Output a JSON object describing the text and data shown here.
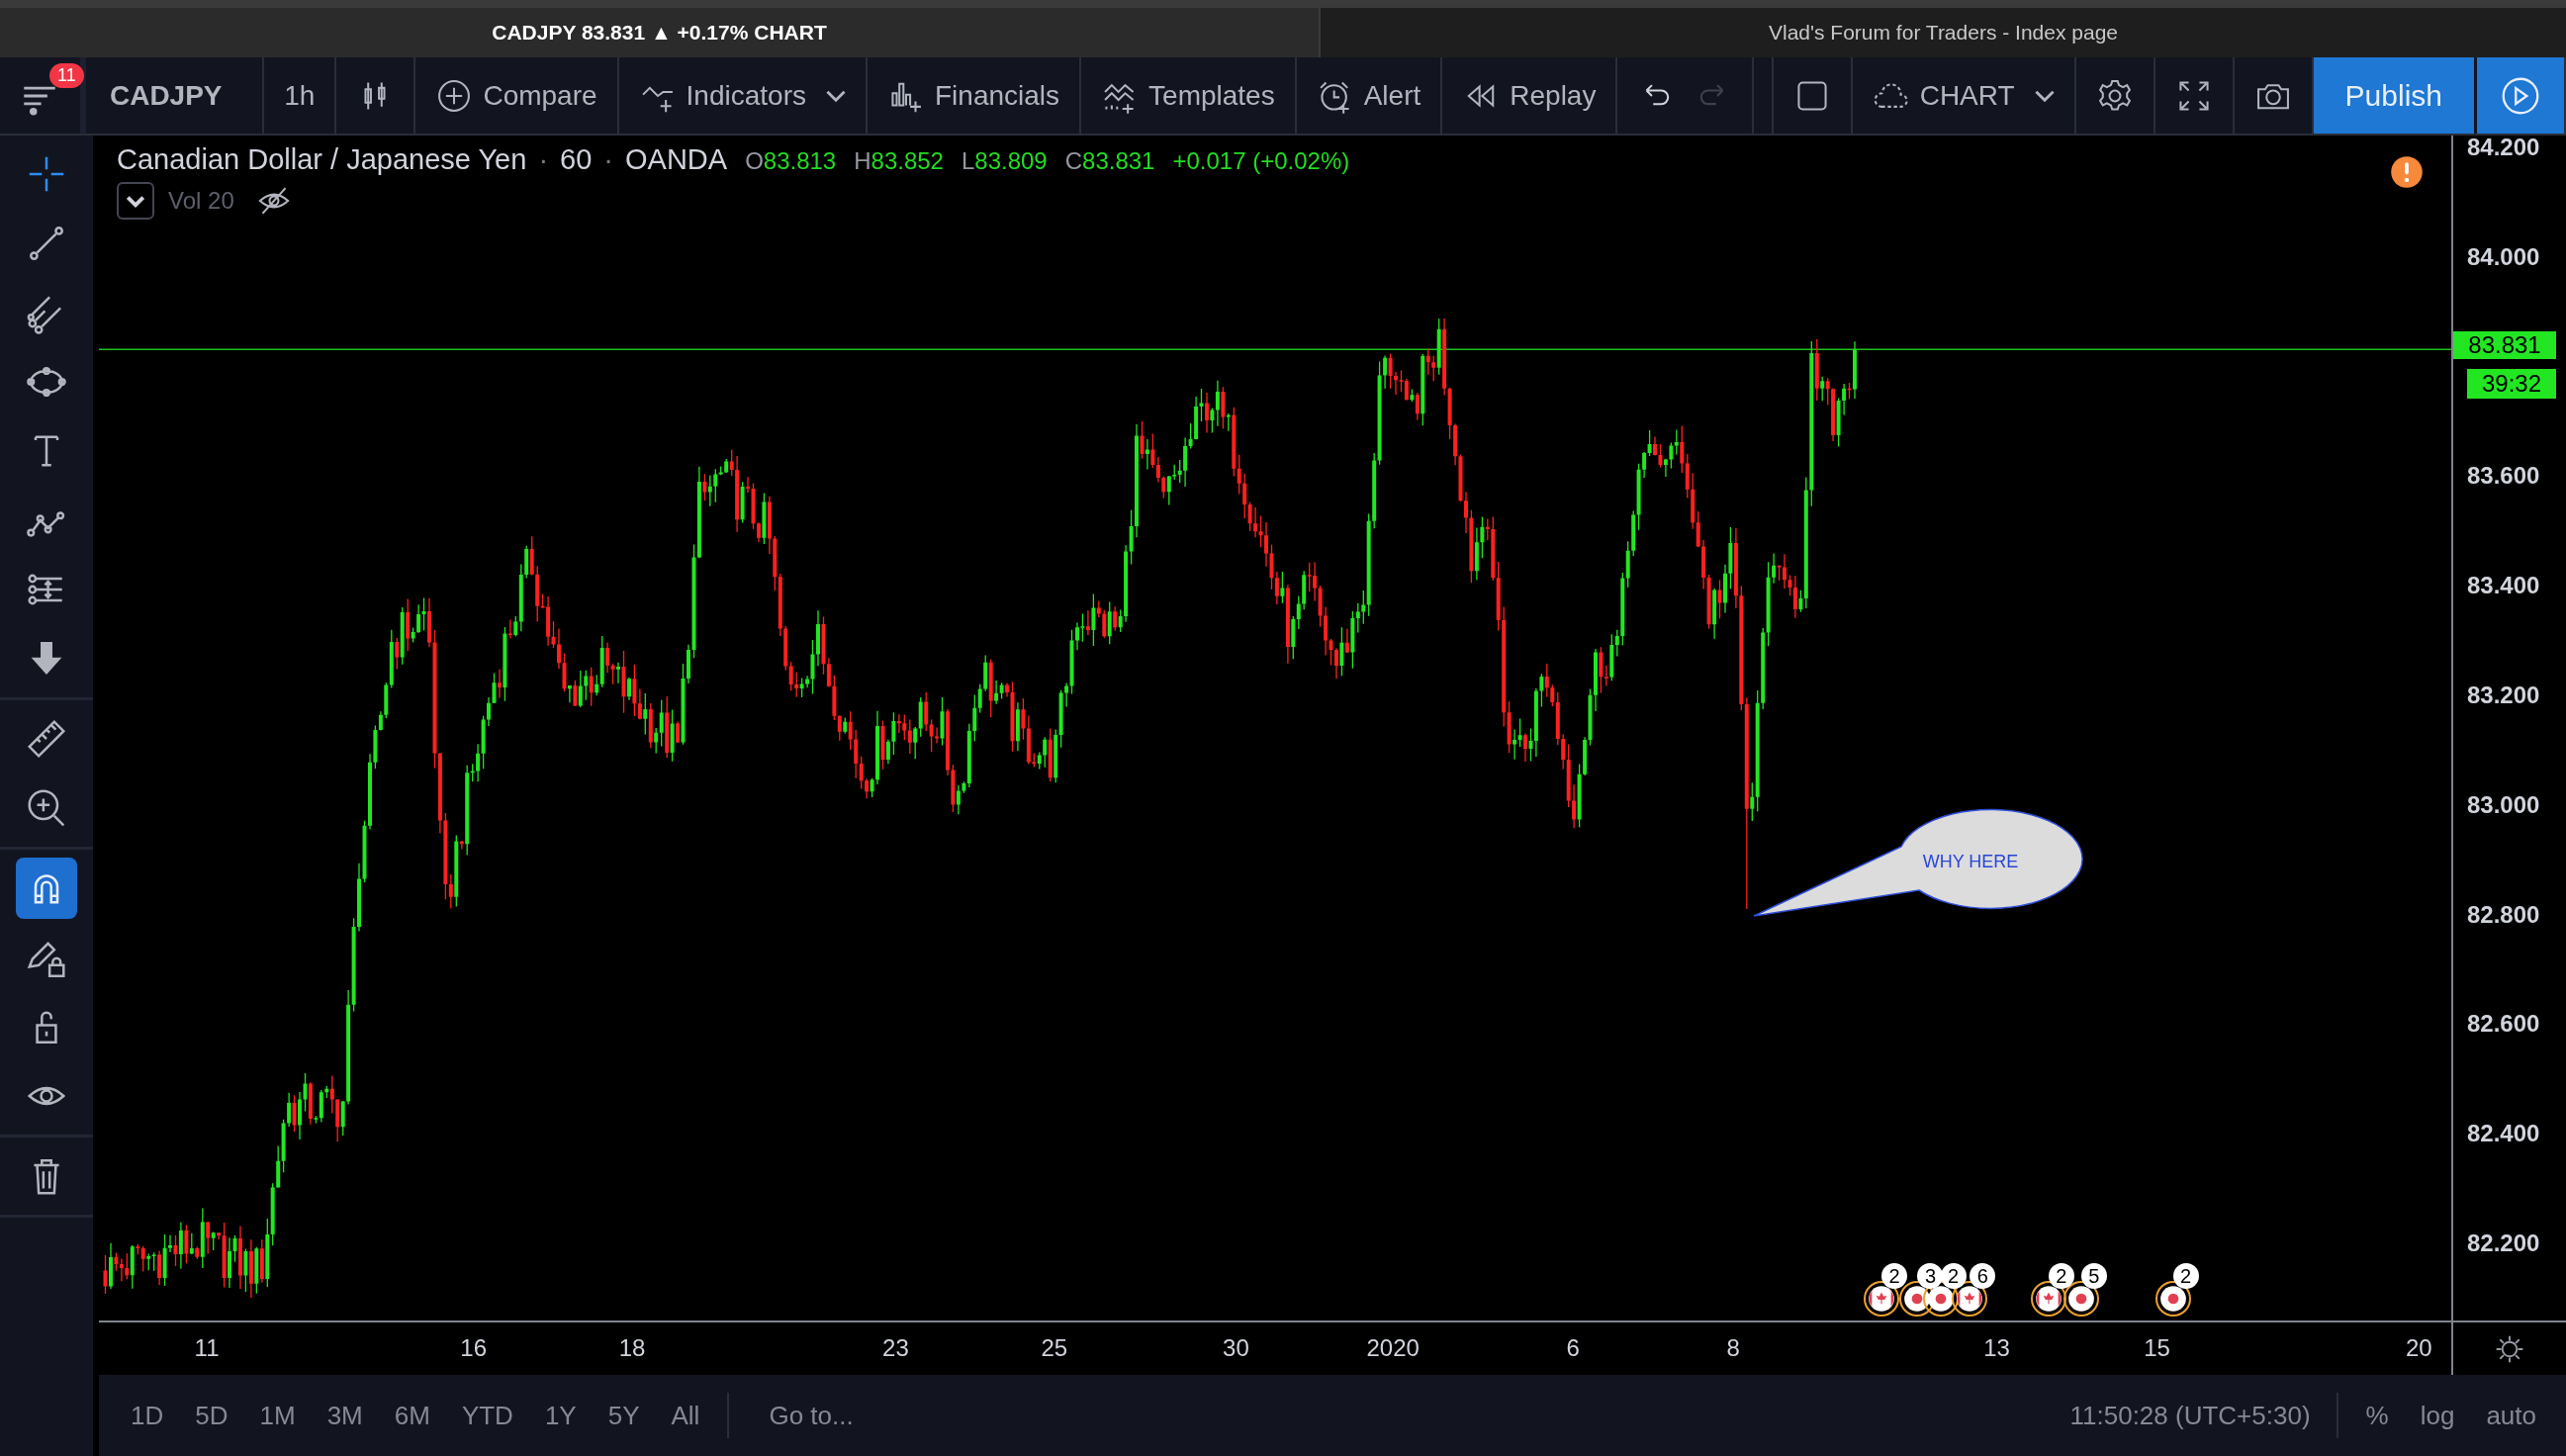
{
  "window_tabs": [
    {
      "title": "CADJPY 83.831 ▲ +0.17% CHART",
      "selected": true
    },
    {
      "title": "Vlad's Forum for Traders - Index page",
      "selected": false
    }
  ],
  "menu": {
    "badge": "11"
  },
  "toolbar": {
    "left": [
      {
        "kind": "symbol",
        "label": "CADJPY"
      },
      {
        "kind": "interval",
        "label": "1h"
      },
      {
        "kind": "candles"
      },
      {
        "kind": "compare",
        "label": "Compare"
      },
      {
        "kind": "indicators",
        "label": "Indicators"
      },
      {
        "kind": "financials",
        "label": "Financials"
      },
      {
        "kind": "templates",
        "label": "Templates"
      },
      {
        "kind": "alert",
        "label": "Alert"
      },
      {
        "kind": "replay",
        "label": "Replay"
      }
    ],
    "history": [
      {
        "kind": "undo",
        "disabled": false
      },
      {
        "kind": "redo",
        "disabled": true
      }
    ],
    "right": [
      {
        "kind": "layout"
      },
      {
        "kind": "cloud",
        "label": "CHART"
      },
      {
        "kind": "settings"
      },
      {
        "kind": "fullscreen"
      },
      {
        "kind": "camera"
      },
      {
        "kind": "publish",
        "label": "Publish"
      },
      {
        "kind": "play"
      }
    ]
  },
  "drawing_tools": [
    {
      "tools": [
        {
          "kind": "crosshair",
          "selected": true,
          "on": false
        },
        {
          "kind": "trend-line",
          "selected": false,
          "on": false
        },
        {
          "kind": "pitchfork",
          "selected": false,
          "on": false
        },
        {
          "kind": "ellipse",
          "selected": false,
          "on": false
        },
        {
          "kind": "text",
          "selected": false,
          "on": false
        },
        {
          "kind": "pattern",
          "selected": false,
          "on": false
        },
        {
          "kind": "measure",
          "selected": false,
          "on": false
        },
        {
          "kind": "arrow-down",
          "selected": false,
          "on": false
        }
      ]
    },
    {
      "tools": [
        {
          "kind": "ruler",
          "selected": false,
          "on": false
        },
        {
          "kind": "zoom",
          "selected": false,
          "on": false
        }
      ]
    },
    {
      "tools": [
        {
          "kind": "magnet",
          "selected": false,
          "on": true
        },
        {
          "kind": "pencil-lock",
          "selected": false,
          "on": false
        },
        {
          "kind": "lock",
          "selected": false,
          "on": false
        },
        {
          "kind": "eye",
          "selected": false,
          "on": false
        }
      ]
    },
    {
      "tools": [
        {
          "kind": "trash",
          "selected": false,
          "on": false
        }
      ]
    }
  ],
  "legend": {
    "parts": [
      "Canadian Dollar / Japanese Yen",
      "·",
      "60",
      "·",
      "OANDA"
    ],
    "ohlc": [
      {
        "key": "O",
        "value": "83.813"
      },
      {
        "key": "H",
        "value": "83.852"
      },
      {
        "key": "L",
        "value": "83.809"
      },
      {
        "key": "C",
        "value": "83.831"
      }
    ],
    "change": "+0.017 (+0.02%)",
    "volume": {
      "label": "Vol 20",
      "hidden": true
    }
  },
  "callout": {
    "text": "WHY HERE"
  },
  "events": [
    {
      "kind": "ca",
      "count": "2"
    },
    {
      "kind": "jp",
      "count": "3"
    },
    {
      "kind": "jp",
      "count": "2"
    },
    {
      "kind": "ca",
      "count": "6"
    },
    {
      "kind": "ca",
      "count": "2"
    },
    {
      "kind": "jp",
      "count": "5"
    },
    {
      "kind": "jp",
      "count": "2"
    }
  ],
  "price_axis": {
    "labels": [
      "84.200",
      "84.000",
      "83.600",
      "83.400",
      "83.200",
      "83.000",
      "82.800",
      "82.600",
      "82.400",
      "82.200"
    ],
    "last_price": "83.831",
    "countdown": "39:32"
  },
  "time_axis": {
    "labels": [
      "11",
      "16",
      "18",
      "23",
      "25",
      "30",
      "2020",
      "6",
      "8",
      "13",
      "15",
      "20"
    ]
  },
  "bottom_bar": {
    "ranges": [
      "1D",
      "5D",
      "1M",
      "3M",
      "6M",
      "YTD",
      "1Y",
      "5Y",
      "All"
    ],
    "goto": "Go to...",
    "time": "11:50:28 (UTC+5:30)",
    "options": [
      "%",
      "log",
      "auto"
    ]
  }
}
